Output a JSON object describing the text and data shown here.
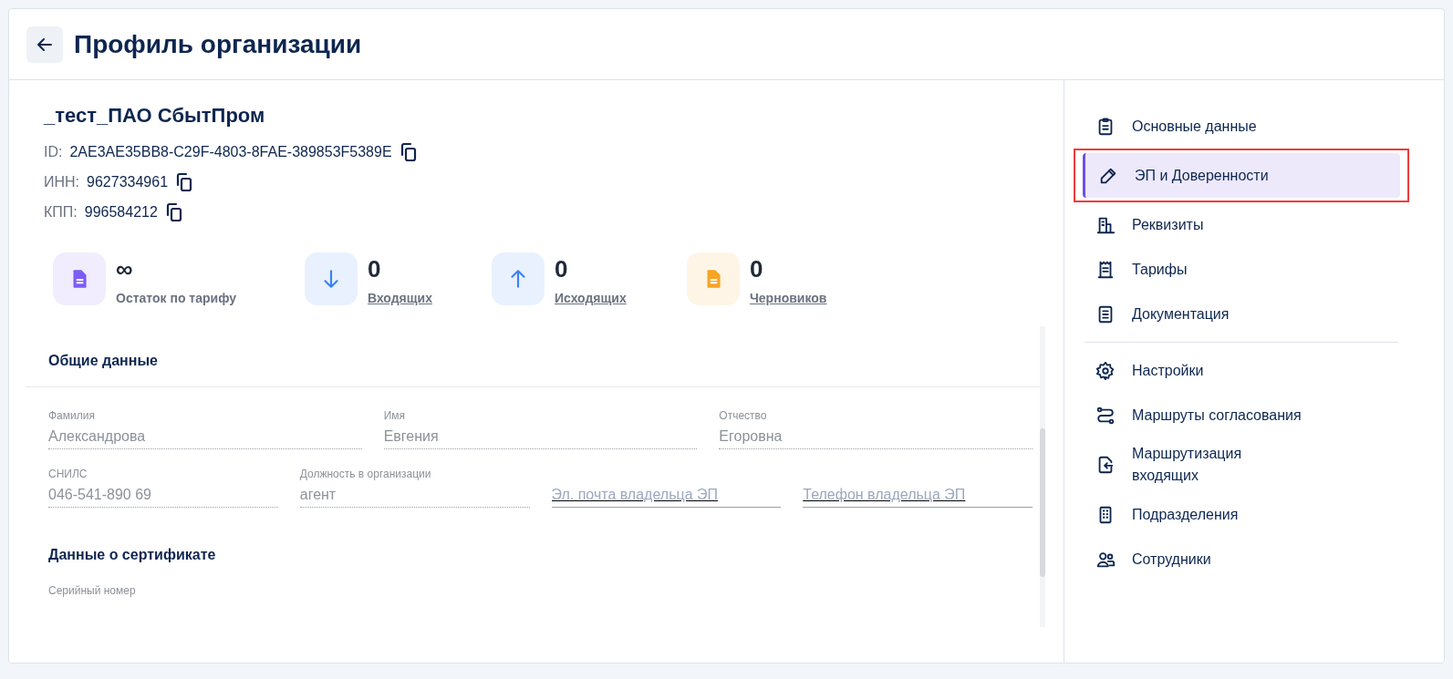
{
  "header": {
    "title": "Профиль организации"
  },
  "organization": {
    "name": "_тест_ПАО СбытПром",
    "details": [
      {
        "label": "ID:",
        "value": "2AE3AE35BB8-C29F-4803-8FAE-389853F5389E"
      },
      {
        "label": "ИНН:",
        "value": "9627334961"
      },
      {
        "label": "КПП:",
        "value": "996584212"
      }
    ]
  },
  "stats": [
    {
      "value": "∞",
      "label": "Остаток по тарифу",
      "link": false,
      "color": "#7c5cf4"
    },
    {
      "value": "0",
      "label": "Входящих",
      "link": true,
      "color": "#3b82f6"
    },
    {
      "value": "0",
      "label": "Исходящих",
      "link": true,
      "color": "#3b82f6"
    },
    {
      "value": "0",
      "label": "Черновиков",
      "link": true,
      "color": "#f5a524"
    }
  ],
  "sections": [
    {
      "title": "Общие данные",
      "rows": [
        [
          {
            "label": "Фамилия",
            "value": "Александрова"
          },
          {
            "label": "Имя",
            "value": "Евгения"
          },
          {
            "label": "Отчество",
            "value": "Егоровна"
          }
        ],
        [
          {
            "label": "СНИЛС",
            "value": "046-541-890 69"
          },
          {
            "label": "Должность в организации",
            "value": "агент"
          },
          {
            "placeholder": "Эл. почта владельца ЭП"
          },
          {
            "placeholder": "Телефон владельца ЭП"
          }
        ]
      ]
    },
    {
      "title": "Данные о сертификате",
      "rows": [
        [
          {
            "label": "Серийный номер"
          }
        ]
      ]
    }
  ],
  "nav": {
    "groups": [
      [
        {
          "label": "Основные данные",
          "selected": false,
          "highlighted": false
        },
        {
          "label": "ЭП и Доверенности",
          "selected": true,
          "highlighted": true
        },
        {
          "label": "Реквизиты",
          "selected": false,
          "highlighted": false
        },
        {
          "label": "Тарифы",
          "selected": false,
          "highlighted": false
        },
        {
          "label": "Документация",
          "selected": false,
          "highlighted": false
        }
      ],
      [
        {
          "label": "Настройки",
          "selected": false,
          "highlighted": false
        },
        {
          "label": "Маршруты согласования",
          "selected": false,
          "highlighted": false
        },
        {
          "label": "Маршрутизация входящих",
          "selected": false,
          "highlighted": false
        },
        {
          "label": "Подразделения",
          "selected": false,
          "highlighted": false
        },
        {
          "label": "Сотрудники",
          "selected": false,
          "highlighted": false
        }
      ]
    ]
  }
}
